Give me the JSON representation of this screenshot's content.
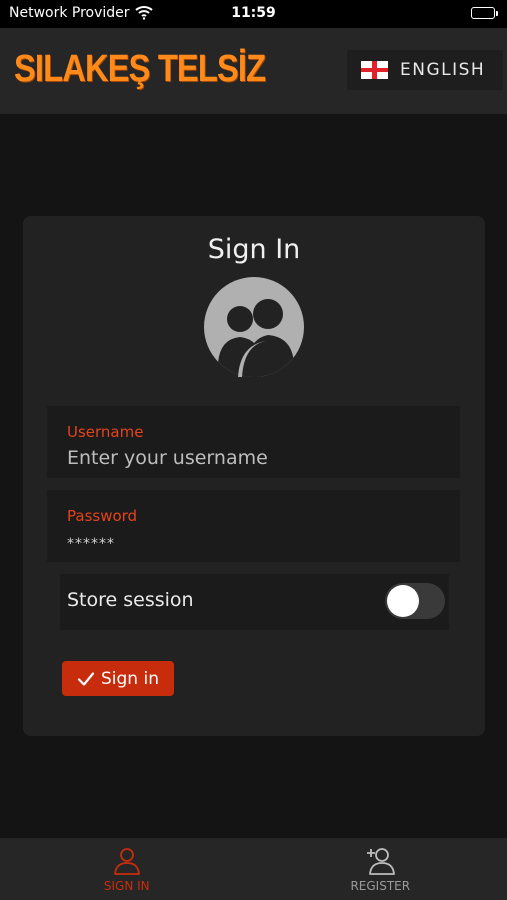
{
  "status_bar": {
    "carrier": "Network Provider",
    "time": "11:59"
  },
  "header": {
    "brand": "SILAKEŞ TELSİZ",
    "language": "ENGLISH",
    "flag_icon": "england-flag-icon"
  },
  "login": {
    "title": "Sign In",
    "avatar_icon": "users-avatar-icon",
    "username_label": "Username",
    "username_placeholder": "Enter your username",
    "username_value": "",
    "password_label": "Password",
    "password_value": "******",
    "store_session_label": "Store session",
    "store_session_on": false,
    "signin_label": "Sign in"
  },
  "tabs": [
    {
      "label": "SIGN IN",
      "icon": "user-icon",
      "active": true
    },
    {
      "label": "REGISTER",
      "icon": "user-plus-icon",
      "active": false
    }
  ],
  "colors": {
    "accent": "#c72d0c",
    "brand": "#ff8a1a",
    "background": "#141414",
    "card": "#222222"
  }
}
